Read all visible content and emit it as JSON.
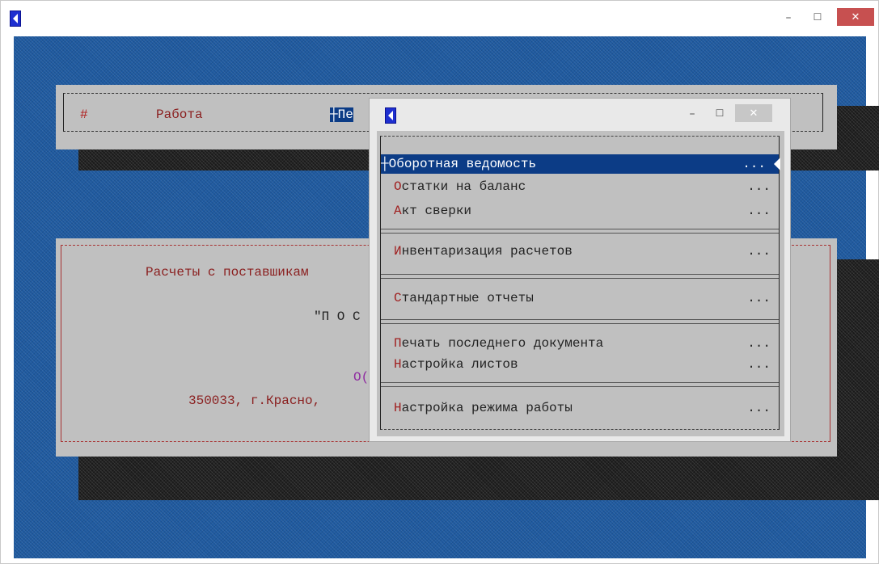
{
  "window": {
    "minimize_label": "–",
    "maximize_label": "☐",
    "close_label": "✕"
  },
  "menubar": {
    "hash": "#",
    "item_work": "Работа",
    "item_print_prefix": "┼",
    "item_print": "Пе"
  },
  "info": {
    "line1": "Расчеты с поставшикам",
    "line2": "\"П О С",
    "line3": "О(",
    "line4": "350033, г.Красно,"
  },
  "popup": {
    "minimize_label": "–",
    "maximize_label": "☐",
    "close_label": "✕",
    "items": [
      {
        "prefix": "┼",
        "first": "О",
        "rest": "боротная ведомость",
        "dots": "..."
      },
      {
        "prefix": "",
        "first": "О",
        "rest": "статки на баланс",
        "dots": "..."
      },
      {
        "prefix": "",
        "first": "А",
        "rest": "кт сверки",
        "dots": "..."
      },
      {
        "prefix": "",
        "first": "И",
        "rest": "нвентаризация расчетов",
        "dots": "..."
      },
      {
        "prefix": "",
        "first": "С",
        "rest": "тандартные отчеты",
        "dots": "..."
      },
      {
        "prefix": "",
        "first": "П",
        "rest": "ечать последнего документа",
        "dots": "..."
      },
      {
        "prefix": "",
        "first": "Н",
        "rest": "астройка листов",
        "dots": "..."
      },
      {
        "prefix": "",
        "first": "Н",
        "rest": "астройка режима работы",
        "dots": "..."
      }
    ]
  },
  "colors": {
    "desktop": "#1f5aa0",
    "panel": "#c0c0c0",
    "highlight": "#0c3c86",
    "hotkey": "#a02020",
    "close_button": "#c75050"
  }
}
